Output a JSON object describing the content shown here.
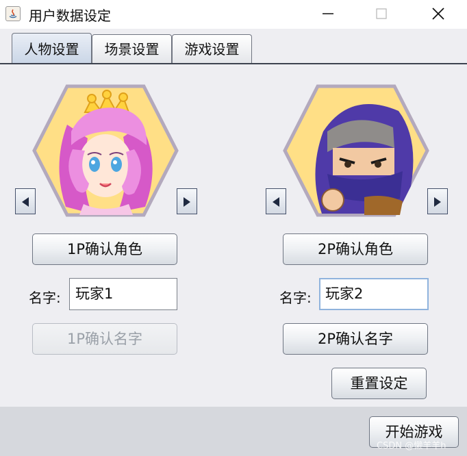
{
  "window": {
    "title": "用户数据设定"
  },
  "tabs": [
    {
      "label": "人物设置",
      "active": true
    },
    {
      "label": "场景设置",
      "active": false
    },
    {
      "label": "游戏设置",
      "active": false
    }
  ],
  "player1": {
    "confirm_character_label": "1P确认角色",
    "name_label": "名字:",
    "name_value": "玩家1",
    "confirm_name_label": "1P确认名字",
    "confirm_name_enabled": false
  },
  "player2": {
    "confirm_character_label": "2P确认角色",
    "name_label": "名字:",
    "name_value": "玩家2",
    "confirm_name_label": "2P确认名字",
    "confirm_name_enabled": true
  },
  "actions": {
    "reset_label": "重置设定",
    "start_label": "开始游戏"
  },
  "watermark": "CSDN @懒羊羊h",
  "colors": {
    "hex_fill": "#ffdf86",
    "hex_border": "#b3a9bd",
    "tab_active": "#c9d5e6"
  }
}
